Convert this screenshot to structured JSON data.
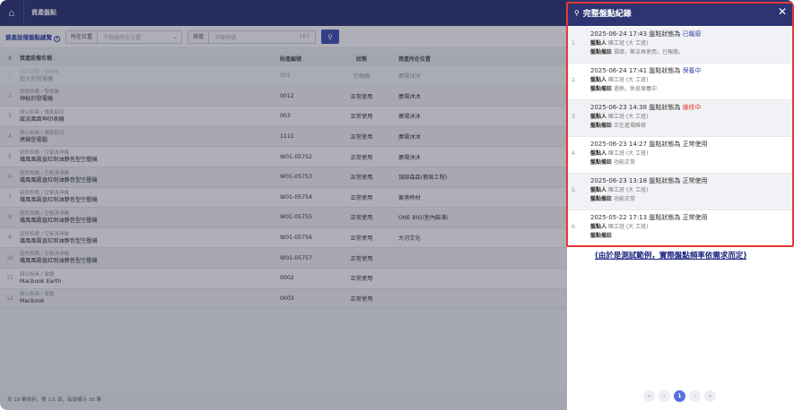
{
  "topbar": {
    "title": "資產盤點"
  },
  "toolbar": {
    "overview_link": "資產設備盤點總覽",
    "location_label": "所在位置",
    "location_placeholder": "不限器所在位置",
    "number_label": "排號",
    "number_placeholder": "不限排號",
    "number_suffix": "183"
  },
  "table": {
    "headers": [
      "#",
      "資產設備名稱",
      "財產編號",
      "狀態",
      "資產所在位置"
    ],
    "rows": [
      {
        "idx": "1",
        "cat": "廚房設備 / 發電機",
        "name": "超大的發電機",
        "code": "001",
        "status": "已報廢",
        "loc": "廣場沐沐",
        "dim": true
      },
      {
        "idx": "2",
        "cat": "廚房設備 / 發電機",
        "name": "神秘的發電機",
        "code": "0012",
        "status": "正常使用",
        "loc": "廣場沐沐",
        "dim": false
      },
      {
        "idx": "3",
        "cat": "辦公用具 / 傳真影印",
        "name": "誕流風面神印表機",
        "code": "003",
        "status": "正常使用",
        "loc": "廣場沐沐",
        "dim": false
      },
      {
        "idx": "4",
        "cat": "辦公用具 / 傳真影印",
        "name": "烤箱型電腦",
        "code": "1111",
        "status": "正常使用",
        "loc": "廣場沐沐",
        "dim": false
      },
      {
        "idx": "5",
        "cat": "廚房設備 / 空氣清淨機",
        "name": "鐵風風霧直紅制油靜音型空壓機",
        "code": "W01-05752",
        "status": "正常使用",
        "loc": "廣場沐沐",
        "dim": false
      },
      {
        "idx": "6",
        "cat": "廚房設備 / 空氣清淨機",
        "name": "鐵風風霧直紅制油靜音型空壓機",
        "code": "W01-05753",
        "status": "正常使用",
        "loc": "頂部森森(葡萄工程)",
        "dim": false
      },
      {
        "idx": "7",
        "cat": "廚房設備 / 空氣清淨機",
        "name": "鐵風風霧直紅制油靜音型空壓機",
        "code": "W01-05754",
        "status": "正常使用",
        "loc": "東港時材",
        "dim": false
      },
      {
        "idx": "8",
        "cat": "廚房設備 / 空氣清淨機",
        "name": "鐵風風霧直紅制油靜音型空壓機",
        "code": "W01-05755",
        "status": "正常使用",
        "loc": "ONE BIG(室內裝潢)",
        "dim": false
      },
      {
        "idx": "9",
        "cat": "廚房設備 / 空氣清淨機",
        "name": "鐵風風霧直紅制油靜音型空壓機",
        "code": "W01-05756",
        "status": "正常使用",
        "loc": "大河文化",
        "dim": false
      },
      {
        "idx": "10",
        "cat": "廚房設備 / 空氣清淨機",
        "name": "鐵風風霧直紅制油靜音型空壓機",
        "code": "W01-05757",
        "status": "正常使用",
        "loc": "",
        "dim": false
      },
      {
        "idx": "11",
        "cat": "辦公用具 / 電腦",
        "name": "Macbook Earth",
        "code": "0002",
        "status": "正常使用",
        "loc": "",
        "dim": false
      },
      {
        "idx": "12",
        "cat": "辦公用具 / 電腦",
        "name": "Macbook",
        "code": "0003",
        "status": "正常使用",
        "loc": "",
        "dim": false
      }
    ]
  },
  "footer": {
    "text": "共 19 筆資料，第 1/1 頁，每頁顯示 30 筆"
  },
  "drawer": {
    "title": "完整盤點紀錄",
    "records": [
      {
        "no": "1.",
        "datetime": "2025-06-24 17:43",
        "prefix": "盤點狀態為",
        "status": "已報廢",
        "status_style": "blue",
        "person_label": "盤點人",
        "person": "陳工班 (大 工班)",
        "remark_label": "盤點備註",
        "remark": "損壞，無法再使用，已報廢。"
      },
      {
        "no": "2.",
        "datetime": "2025-06-24 17:41",
        "prefix": "盤點狀態為",
        "status": "保養中",
        "status_style": "blue",
        "person_label": "盤點人",
        "person": "陳工班 (大 工班)",
        "remark_label": "盤點備註",
        "remark": "過熱，休息保養中"
      },
      {
        "no": "3.",
        "datetime": "2025-06-23 14:38",
        "prefix": "盤點狀態為",
        "status": "維修中",
        "status_style": "red",
        "person_label": "盤點人",
        "person": "陳工班 (大 工班)",
        "remark_label": "盤點備註",
        "remark": "正在進場維修"
      },
      {
        "no": "4.",
        "datetime": "2025-06-23 14:27",
        "prefix": "盤點狀態為",
        "status": "正常使用",
        "status_style": "plain",
        "person_label": "盤點人",
        "person": "陳工班 (大 工班)",
        "remark_label": "盤點備註",
        "remark": "功能正常"
      },
      {
        "no": "5.",
        "datetime": "2025-06-23 13:18",
        "prefix": "盤點狀態為",
        "status": "正常使用",
        "status_style": "plain",
        "person_label": "盤點人",
        "person": "陳工班 (大 工班)",
        "remark_label": "盤點備註",
        "remark": "功能正常"
      },
      {
        "no": "6.",
        "datetime": "2025-05-22 17:13",
        "prefix": "盤點狀態為",
        "status": "正常使用",
        "status_style": "plain",
        "person_label": "盤點人",
        "person": "陳工班 (大 工班)",
        "remark_label": "盤點備註",
        "remark": ""
      }
    ],
    "note": "(由於是測試範例，實際盤點頻率依需求而定)",
    "pagination": {
      "first": "«",
      "prev": "‹",
      "current": "1",
      "next": "›",
      "last": "»"
    }
  },
  "colors": {
    "header": "#2c3472",
    "accent": "#3f51b5",
    "highlight": "#e53935"
  },
  "icons": {
    "home": "home-icon",
    "search": "search-icon",
    "close": "close-icon",
    "info": "info-icon"
  }
}
